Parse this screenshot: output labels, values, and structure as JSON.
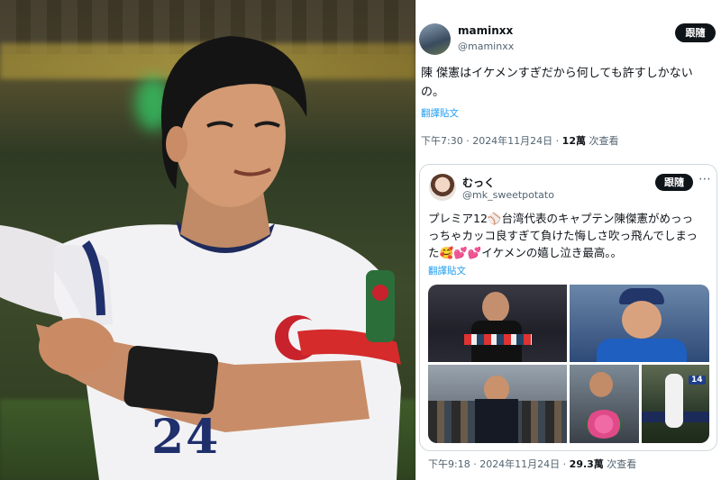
{
  "tweet": {
    "name": "maminxx",
    "handle": "@maminxx",
    "follow_label": "跟隨",
    "text_line1": "陳 傑憲はイケメンすぎだから何しても許すしかない",
    "text_line2": "の。",
    "translate_label": "翻譯貼文",
    "time": "下午7:30 · 2024年11月24日 · ",
    "views_count": "12萬",
    "views_label": " 次查看"
  },
  "quote": {
    "name": "むっく",
    "handle": "@mk_sweetpotato",
    "follow_label": "跟隨",
    "text_line1": "プレミア12⚾台湾代表のキャプテン陳傑憲がめっっ",
    "text_line2": "っちゃカッコ良すぎて負けた悔しさ吹っ飛んでしまっ",
    "text_line3": "た🥰💕💕イケメンの嬉し泣き最高。。",
    "translate_label": "翻譯貼文",
    "time": "下午9:18 · 2024年11月24日 · ",
    "views_count": "29.3萬",
    "views_label": " 次查看"
  },
  "photo": {
    "jersey_number": "24"
  },
  "grid": {
    "badge": "14"
  },
  "colors": {
    "link": "#1d9bf0",
    "secondary_text": "#536471",
    "follow_bg": "#0f1419"
  }
}
